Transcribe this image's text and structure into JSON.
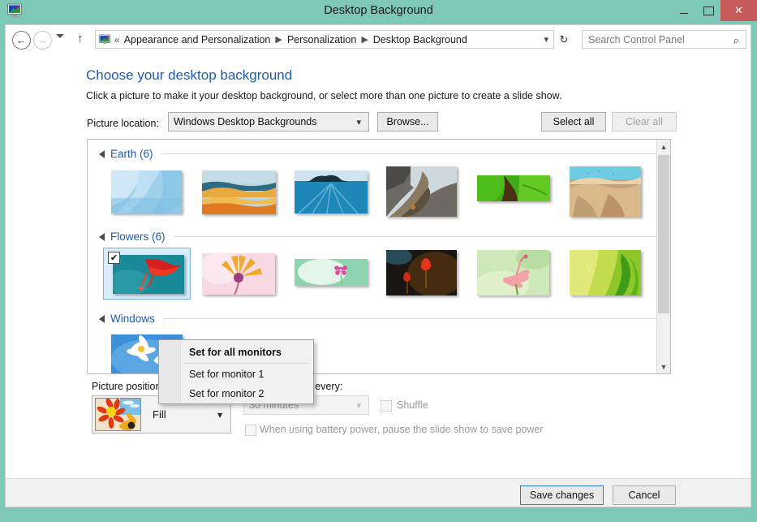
{
  "window": {
    "title": "Desktop Background",
    "app_icon": "display-monitor-icon",
    "controls": {
      "minimize": "minimize-icon",
      "maximize": "maximize-icon",
      "close": "✕"
    }
  },
  "nav": {
    "back": "back-icon",
    "forward": "forward-icon",
    "recent": "recent-pages-icon",
    "up": "up-icon",
    "breadcrumb": {
      "overflow": "«",
      "items": [
        "Appearance and Personalization",
        "Personalization",
        "Desktop Background"
      ],
      "dropdown": "chevron-down-icon"
    },
    "refresh": "refresh-icon"
  },
  "search": {
    "placeholder": "Search Control Panel",
    "icon": "search-icon"
  },
  "main": {
    "heading": "Choose your desktop background",
    "subheading": "Click a picture to make it your desktop background, or select more than one picture to create a slide show.",
    "picture_location_label": "Picture location:",
    "picture_location_value": "Windows Desktop Backgrounds",
    "browse_label": "Browse...",
    "select_all_label": "Select all",
    "clear_all_label": "Clear all"
  },
  "gallery": {
    "groups": [
      {
        "label": "Earth (6)",
        "count": 6,
        "expanded": true
      },
      {
        "label": "Flowers (6)",
        "count": 6,
        "expanded": true
      },
      {
        "label": "Windows",
        "count": null,
        "expanded": true
      }
    ],
    "selected_index": 0,
    "checkbox_glyph": "✔",
    "scrollbar": {
      "up": "scroll-up-icon",
      "down": "scroll-down-icon"
    }
  },
  "context_menu": {
    "items": [
      {
        "label": "Set for all monitors",
        "bold": true
      },
      {
        "label": "Set for monitor 1",
        "bold": false
      },
      {
        "label": "Set for monitor 2",
        "bold": false
      }
    ]
  },
  "settings": {
    "picture_position_label": "Picture position:",
    "picture_position_value": "Fill",
    "change_picture_label": "Change picture every:",
    "change_picture_value": "30 minutes",
    "shuffle_label": "Shuffle",
    "shuffle_checked": false,
    "battery_label": "When using battery power, pause the slide show to save power",
    "battery_checked": false
  },
  "footer": {
    "save_label": "Save changes",
    "cancel_label": "Cancel"
  },
  "colors": {
    "desktop": "#7ec8b8",
    "accent_link": "#1a5dab",
    "close_button": "#c75b5b",
    "selection": "#d9ecfb",
    "focus_border": "#2a7fd4"
  }
}
